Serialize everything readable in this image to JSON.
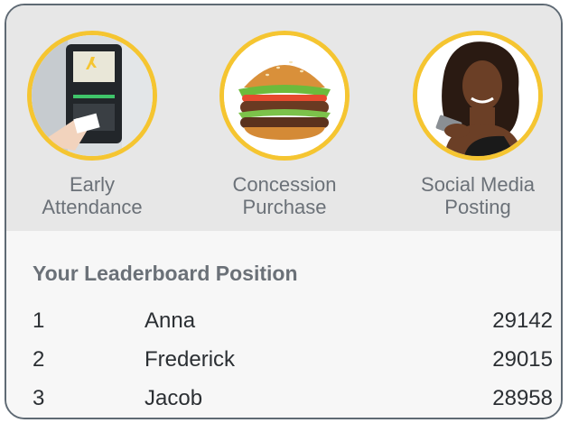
{
  "activities": [
    {
      "label": "Early\nAttendance",
      "icon": "ticket-kiosk-icon"
    },
    {
      "label": "Concession\nPurchase",
      "icon": "hamburger-icon"
    },
    {
      "label": "Social Media\nPosting",
      "icon": "phone-user-icon"
    }
  ],
  "leaderboard": {
    "title": "Your Leaderboard Position",
    "rows": [
      {
        "rank": "1",
        "name": "Anna",
        "score": "29142"
      },
      {
        "rank": "2",
        "name": "Frederick",
        "score": "29015"
      },
      {
        "rank": "3",
        "name": "Jacob",
        "score": "28958"
      }
    ]
  },
  "colors": {
    "ring": "#f5c531",
    "border": "#5f6a74",
    "label_text": "#6b7178",
    "row_text": "#2b2f33",
    "top_band": "#e7e7e7",
    "bottom_band": "#f7f7f7"
  }
}
